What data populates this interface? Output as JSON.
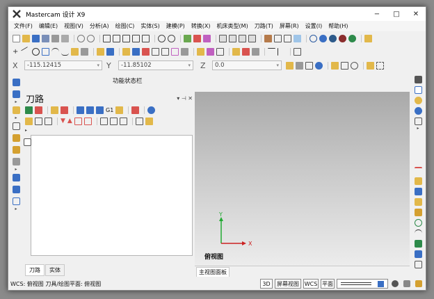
{
  "window": {
    "title": "Mastercam 设计 X9",
    "controls": [
      "−",
      "□",
      "✕"
    ]
  },
  "menu": [
    "文件(F)",
    "编辑(E)",
    "视图(V)",
    "分析(A)",
    "绘图(C)",
    "实体(S)",
    "建模(P)",
    "转换(X)",
    "机床类型(M)",
    "刀路(T)",
    "屏幕(R)",
    "设置(I)",
    "帮助(H)"
  ],
  "coords": {
    "x_label": "X",
    "x_value": "-115.12415",
    "y_label": "Y",
    "y_value": "-11.85102",
    "z_label": "Z",
    "z_value": "0.0"
  },
  "function_status_bar": "功能状态栏",
  "toolpath_panel": {
    "title": "刀路",
    "pin": "▾ ⊣ ✕",
    "g1_label": "G1",
    "tabs": [
      "刀路",
      "实体"
    ]
  },
  "viewport": {
    "view_name": "俯视图",
    "axis_y": "Y",
    "axis_x": "X",
    "tab": "主视图面板"
  },
  "status": {
    "text": "WCS: 俯视图  刀具/绘图平面: 俯视图",
    "btn_3d": "3D",
    "btn_screen_view": "屏幕视图",
    "btn_wcs": "WCS",
    "btn_plane": "平面"
  },
  "colors": {
    "accent": "#3a6fc4",
    "axis_x": "#cc2222",
    "axis_y": "#22aa33"
  }
}
